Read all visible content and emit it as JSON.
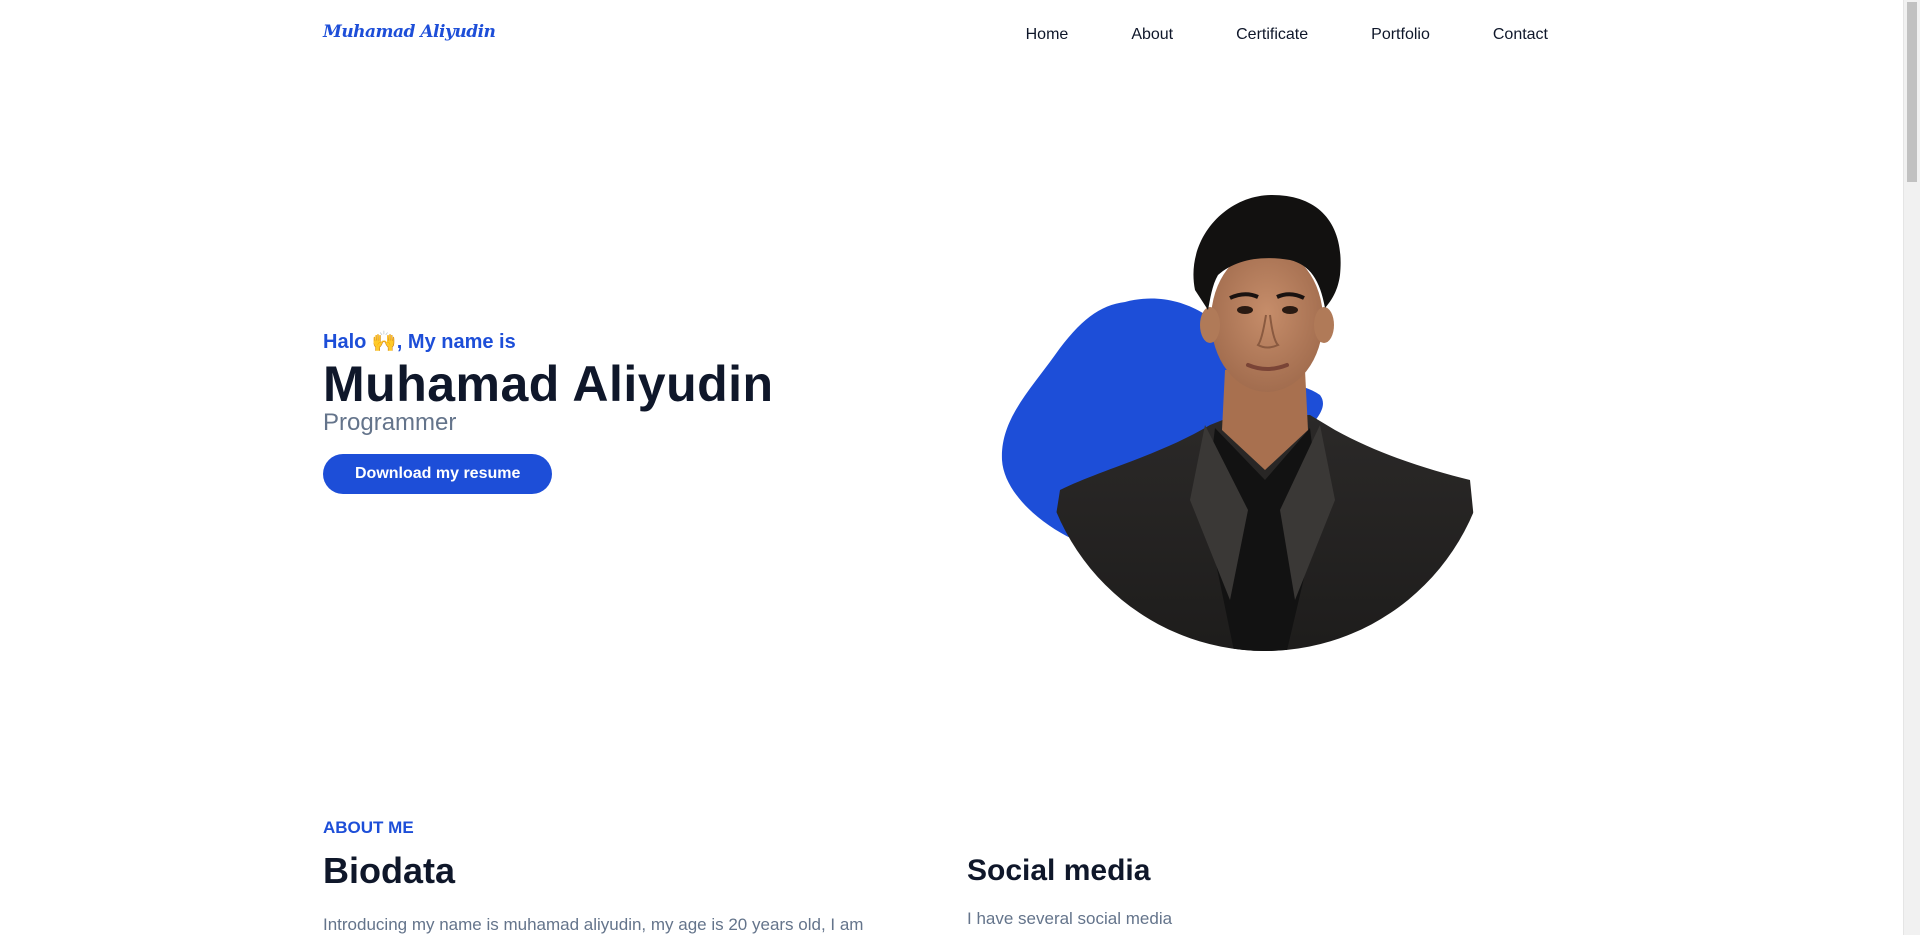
{
  "header": {
    "logo": "Muhamad Aliyudin",
    "nav": [
      "Home",
      "About",
      "Certificate",
      "Portfolio",
      "Contact"
    ]
  },
  "hero": {
    "greeting": "Halo 🙌, My name is",
    "name": "Muhamad Aliyudin",
    "role": "Programmer",
    "resume_button": "Download my resume"
  },
  "about": {
    "eyebrow": "ABOUT ME",
    "title": "Biodata",
    "text": "Introducing my name is muhamad aliyudin, my age is 20 years old, I am",
    "social_title": "Social media",
    "social_text": "I have several social media"
  },
  "colors": {
    "accent": "#1d4ed8",
    "text": "#0f172a",
    "muted": "#64748b"
  }
}
